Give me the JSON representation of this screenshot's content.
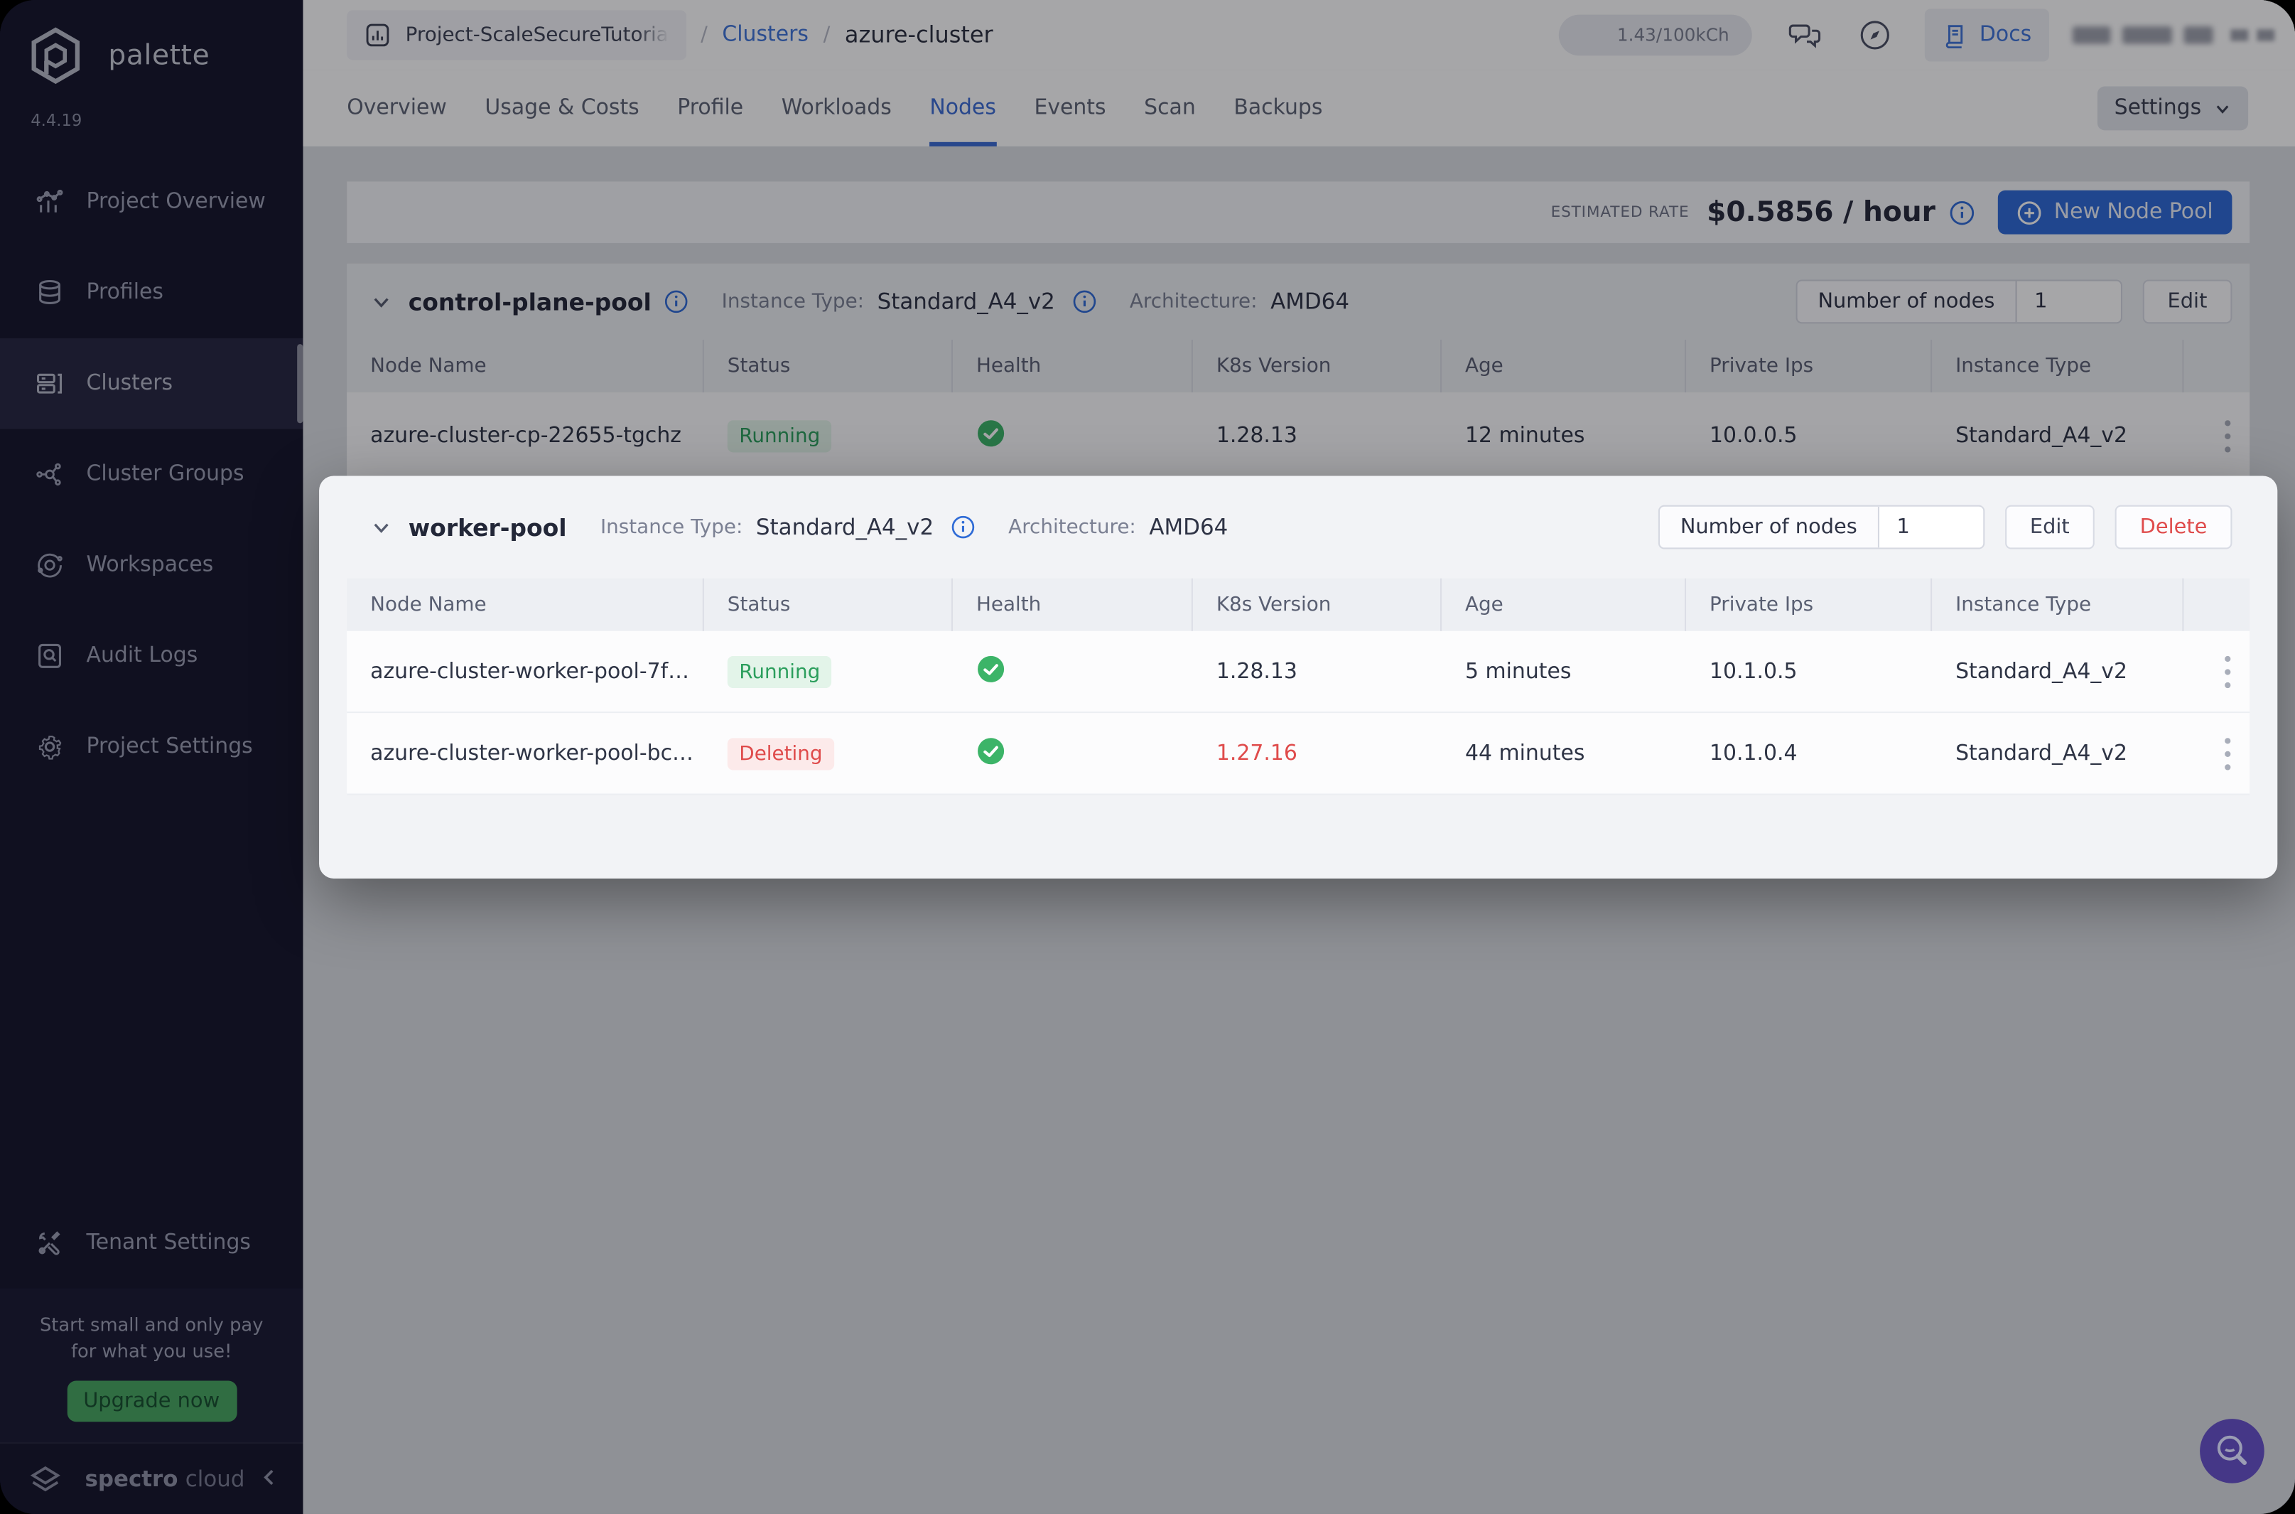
{
  "sidebar": {
    "logo_text": "palette",
    "version": "4.4.19",
    "items": [
      {
        "label": "Project Overview"
      },
      {
        "label": "Profiles"
      },
      {
        "label": "Clusters"
      },
      {
        "label": "Cluster Groups"
      },
      {
        "label": "Workspaces"
      },
      {
        "label": "Audit Logs"
      },
      {
        "label": "Project Settings"
      }
    ],
    "active_item": "Clusters",
    "tenant_settings_label": "Tenant Settings",
    "promo": {
      "line1": "Start small and only pay",
      "line2": "for what you use!",
      "cta": "Upgrade now"
    },
    "brand_word1": "spectro",
    "brand_word2": "cloud"
  },
  "header": {
    "project": "Project-ScaleSecureTutoria",
    "separator": "/",
    "clusters_link": "Clusters",
    "cluster_name": "azure-cluster",
    "credits": "1.43/100kCh",
    "docs": "Docs"
  },
  "tabs": {
    "items": [
      "Overview",
      "Usage & Costs",
      "Profile",
      "Workloads",
      "Nodes",
      "Events",
      "Scan",
      "Backups"
    ],
    "active": "Nodes",
    "settings": "Settings"
  },
  "ratebar": {
    "label": "ESTIMATED RATE",
    "value": "$0.5856 / hour",
    "new_node_pool": "New Node Pool"
  },
  "table_columns": [
    "Node Name",
    "Status",
    "Health",
    "K8s Version",
    "Age",
    "Private Ips",
    "Instance Type"
  ],
  "pools": [
    {
      "name": "control-plane-pool",
      "instance_type_label": "Instance Type:",
      "instance_type": "Standard_A4_v2",
      "architecture_label": "Architecture:",
      "architecture": "AMD64",
      "nodes_label": "Number of nodes",
      "nodes_value": "1",
      "edit": "Edit",
      "rows": [
        {
          "name": "azure-cluster-cp-22655-tgchz",
          "status": "Running",
          "k8s": "1.28.13",
          "age": "12 minutes",
          "ip": "10.0.0.5",
          "type": "Standard_A4_v2"
        }
      ]
    },
    {
      "name": "worker-pool",
      "instance_type_label": "Instance Type:",
      "instance_type": "Standard_A4_v2",
      "architecture_label": "Architecture:",
      "architecture": "AMD64",
      "nodes_label": "Number of nodes",
      "nodes_value": "1",
      "edit": "Edit",
      "delete": "Delete",
      "rows": [
        {
          "name": "azure-cluster-worker-pool-7f…",
          "status": "Running",
          "k8s": "1.28.13",
          "age": "5 minutes",
          "ip": "10.1.0.5",
          "type": "Standard_A4_v2"
        },
        {
          "name": "azure-cluster-worker-pool-bc…",
          "status": "Deleting",
          "k8s": "1.27.16",
          "age": "44 minutes",
          "ip": "10.1.0.4",
          "type": "Standard_A4_v2"
        }
      ]
    }
  ],
  "colors": {
    "accent_blue": "#3a6bd3",
    "success_green": "#2b9e5c",
    "danger_red": "#df4b4b",
    "brand_purple": "#6a52c3",
    "upgrade_green": "#47a660"
  }
}
